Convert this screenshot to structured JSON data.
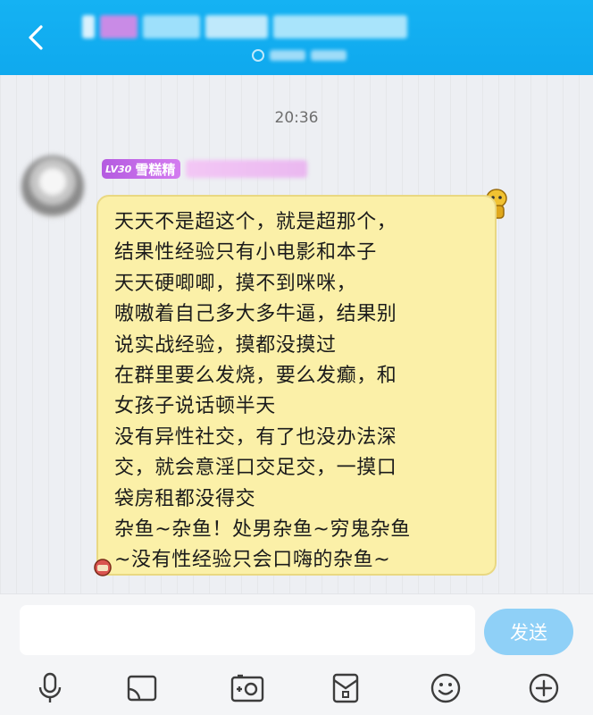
{
  "header": {
    "title": "",
    "subtitle": "",
    "colors": {
      "background": "#12aef2"
    }
  },
  "chat": {
    "timestamp": "20:36",
    "message": {
      "sender_level": "LV30",
      "sender_name": "雪糕精",
      "text": "天天不是超这个，就是超那个，\n结果性经验只有小电影和本子\n天天硬唧唧，摸不到咪咪，\n嗷嗷着自己多大多牛逼，结果别\n说实战经验，摸都没摸过\n在群里要么发烧，要么发癫，和\n女孩子说话顿半天\n没有异性社交，有了也没办法深\n交，就会意淫口交足交，一摸口\n袋房租都没得交\n杂鱼~杂鱼！处男杂鱼~穷鬼杂鱼\n~没有性经验只会口嗨的杂鱼~",
      "bubble_color": "#fbf0a8"
    }
  },
  "input": {
    "value": "",
    "send_label": "发送"
  },
  "toolbar": {
    "icons": [
      "microphone-icon",
      "image-icon",
      "camera-icon",
      "red-packet-icon",
      "emoji-icon",
      "plus-icon"
    ]
  }
}
